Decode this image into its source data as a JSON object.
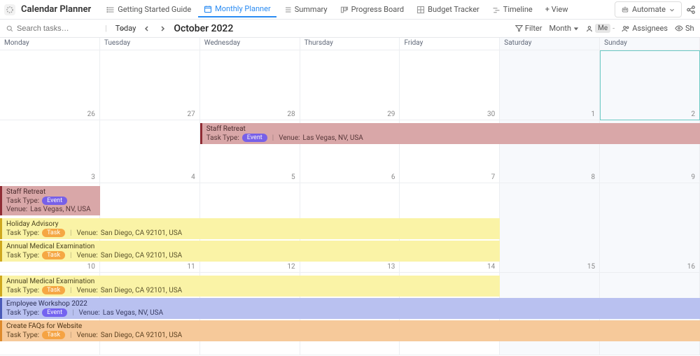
{
  "header": {
    "tableName": "Calendar Planner",
    "automate": "Automate"
  },
  "views": {
    "items": [
      {
        "label": "Getting Started Guide"
      },
      {
        "label": "Monthly Planner",
        "active": true
      },
      {
        "label": "Summary"
      },
      {
        "label": "Progress Board"
      },
      {
        "label": "Budget Tracker"
      },
      {
        "label": "Timeline"
      }
    ],
    "addView": "+ View"
  },
  "toolbar": {
    "searchPlaceholder": "Search tasks…",
    "today": "Today",
    "period": "October 2022",
    "filter": "Filter",
    "scale": "Month",
    "me": "Me",
    "assignees": "Assignees",
    "show": "Show"
  },
  "days": {
    "mon": "Monday",
    "tue": "Tuesday",
    "wed": "Wednesday",
    "thu": "Thursday",
    "fri": "Friday",
    "sat": "Saturday",
    "sun": "Sunday"
  },
  "dates": {
    "r1": [
      "26",
      "27",
      "28",
      "29",
      "30",
      "1",
      "2"
    ],
    "r2": [
      "3",
      "4",
      "5",
      "6",
      "7",
      "8",
      "9"
    ],
    "r3": [
      "10",
      "11",
      "12",
      "13",
      "14",
      "15",
      "16"
    ],
    "r4": [
      "",
      "",
      "",
      "",
      "",
      "",
      ""
    ]
  },
  "labels": {
    "taskTypePrefix": "Task Type:",
    "venuePrefix": "Venue:",
    "pillEvent": "Event",
    "pillTask": "Task"
  },
  "events": {
    "staffRetreat1": {
      "title": "Staff Retreat",
      "venue": " Las Vegas, NV, USA"
    },
    "staffRetreat2": {
      "title": "Staff Retreat",
      "venue": " Las Vegas, NV, USA"
    },
    "holidayAdvisory": {
      "title": "Holiday Advisory",
      "venue": " San Diego, CA 92101, USA"
    },
    "medical1": {
      "title": "Annual Medical Examination",
      "venue": " San Diego, CA 92101, USA"
    },
    "medical2": {
      "title": "Annual Medical Examination",
      "venue": " San Diego, CA 92101, USA"
    },
    "workshop": {
      "title": "Employee Workshop 2022",
      "venue": " Las Vegas, NV, USA"
    },
    "faqs": {
      "title": "Create FAQs for Website",
      "venue": " San Diego, CA 92101, USA"
    }
  }
}
